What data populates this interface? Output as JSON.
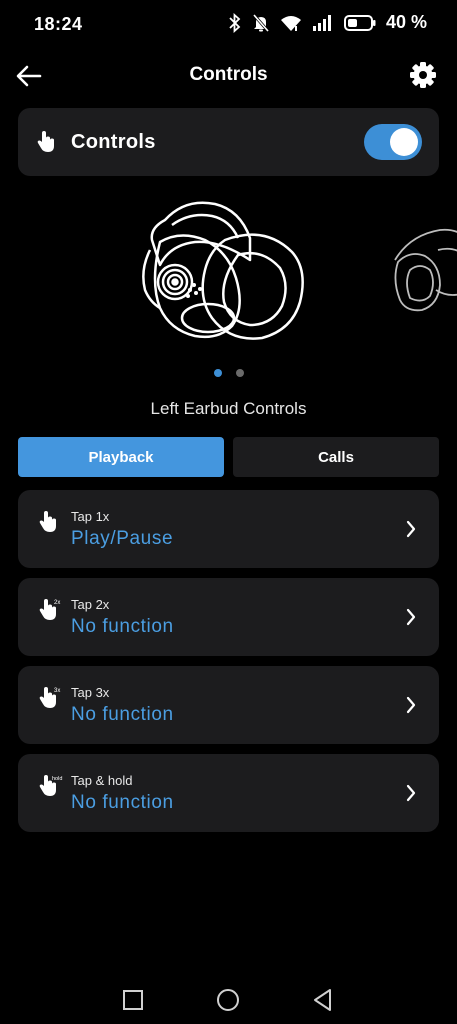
{
  "status": {
    "time": "18:24",
    "battery_percent": "40 %"
  },
  "header": {
    "title": "Controls"
  },
  "master": {
    "label": "Controls",
    "enabled": true
  },
  "carousel": {
    "pages": 2,
    "active_page": 1
  },
  "section_title": "Left Earbud Controls",
  "tabs": [
    {
      "label": "Playback",
      "active": true
    },
    {
      "label": "Calls",
      "active": false
    }
  ],
  "gestures": [
    {
      "name": "Tap 1x",
      "value": "Play/Pause",
      "badge": ""
    },
    {
      "name": "Tap 2x",
      "value": "No function",
      "badge": "2x"
    },
    {
      "name": "Tap 3x",
      "value": "No function",
      "badge": "3x"
    },
    {
      "name": "Tap & hold",
      "value": "No function",
      "badge": "hold"
    }
  ],
  "colors": {
    "accent": "#4496de",
    "value_text": "#4b9ee2",
    "card_bg": "#1c1c1e",
    "background": "#000000"
  }
}
